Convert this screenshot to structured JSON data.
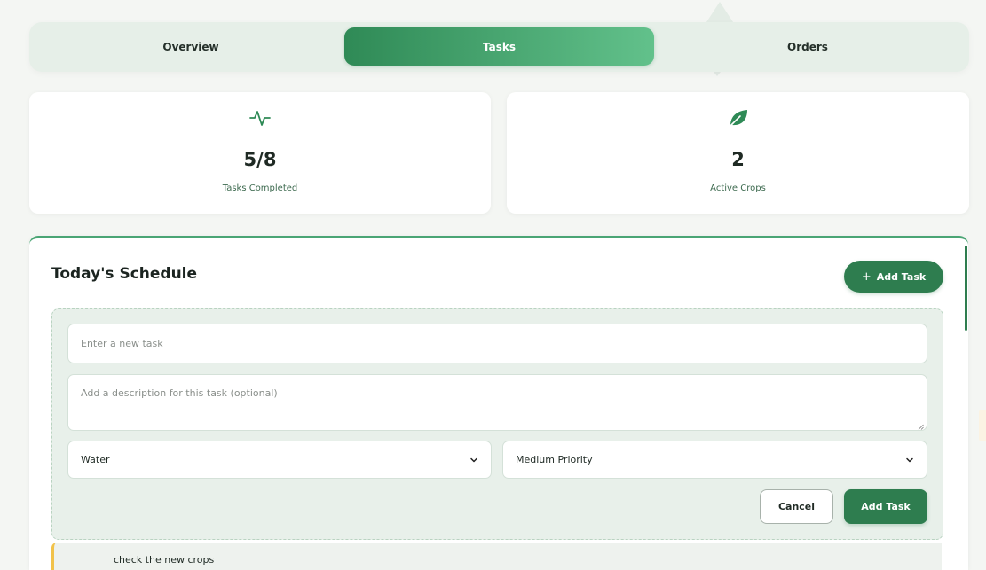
{
  "tabs": [
    {
      "label": "Overview",
      "active": false
    },
    {
      "label": "Tasks",
      "active": true
    },
    {
      "label": "Orders",
      "active": false
    }
  ],
  "stats": [
    {
      "icon": "activity-icon",
      "value": "5/8",
      "label": "Tasks Completed"
    },
    {
      "icon": "leaf-icon",
      "value": "2",
      "label": "Active Crops"
    }
  ],
  "schedule": {
    "title": "Today's Schedule",
    "add_button_label": "Add Task",
    "form": {
      "task_placeholder": "Enter a new task",
      "description_placeholder": "Add a description for this task (optional)",
      "category_value": "Water",
      "priority_value": "Medium Priority",
      "cancel_label": "Cancel",
      "submit_label": "Add Task"
    },
    "tasks": [
      {
        "title": "check the new crops"
      }
    ]
  },
  "colors": {
    "accent": "#2e7d4f",
    "tab_gradient_start": "#2f8a56",
    "tab_gradient_end": "#62c18b",
    "priority_marker": "#f1c24a"
  }
}
